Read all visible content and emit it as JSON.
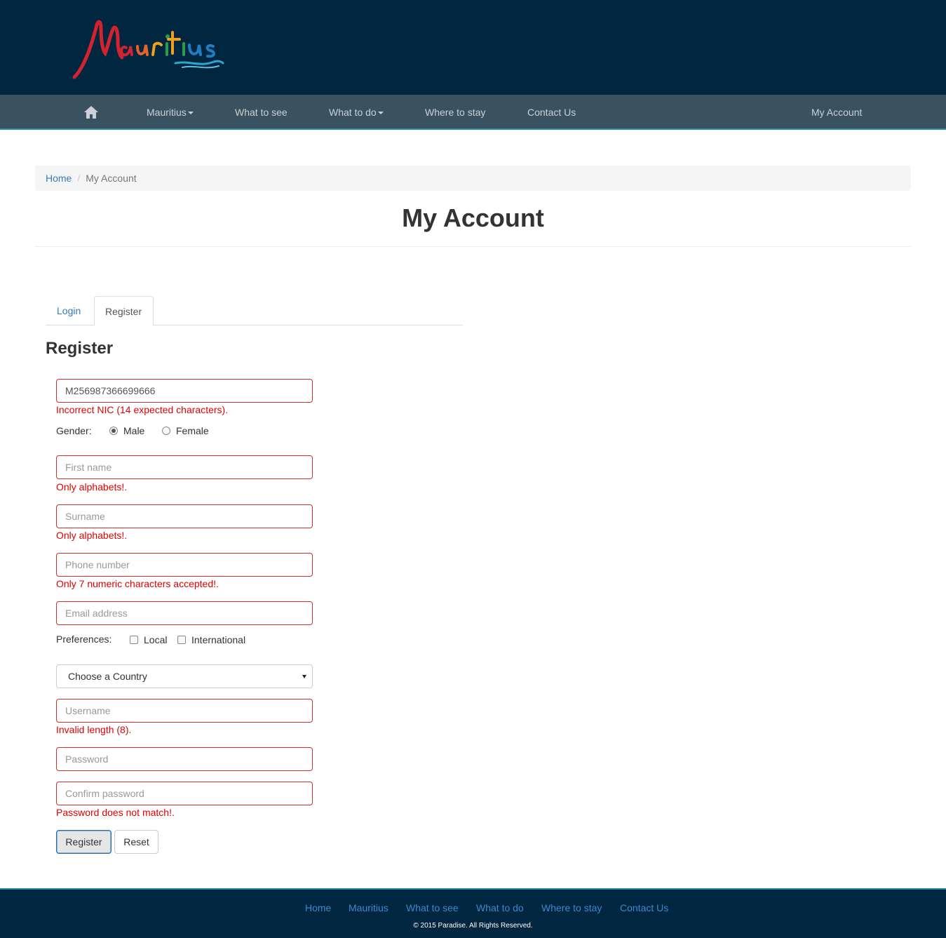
{
  "header": {
    "logo_text": "Mauritius"
  },
  "nav": {
    "home_icon": "home-icon",
    "items": [
      {
        "label": "Mauritius",
        "has_dropdown": true
      },
      {
        "label": "What to see",
        "has_dropdown": false
      },
      {
        "label": "What to do",
        "has_dropdown": true
      },
      {
        "label": "Where to stay",
        "has_dropdown": false
      },
      {
        "label": "Contact Us",
        "has_dropdown": false
      }
    ],
    "account": "My Account"
  },
  "breadcrumb": {
    "home": "Home",
    "separator": "/",
    "current": "My Account"
  },
  "page_title": "My Account",
  "tabs": {
    "login": "Login",
    "register": "Register",
    "active": "Register"
  },
  "form": {
    "heading": "Register",
    "nic": {
      "value": "M256987366699666",
      "error": "Incorrect NIC (14 expected characters)."
    },
    "gender": {
      "label": "Gender:",
      "options": [
        "Male",
        "Female"
      ],
      "selected": "Male"
    },
    "first_name": {
      "placeholder": "First name",
      "error": "Only alphabets!."
    },
    "surname": {
      "placeholder": "Surname",
      "error": "Only alphabets!."
    },
    "phone": {
      "placeholder": "Phone number",
      "error": "Only 7 numeric characters accepted!."
    },
    "email": {
      "placeholder": "Email address"
    },
    "preferences": {
      "label": "Preferences:",
      "options": [
        "Local",
        "International"
      ],
      "checked": []
    },
    "country": {
      "selected": "Choose a Country"
    },
    "username": {
      "placeholder": "Username",
      "error": "Invalid length (8)."
    },
    "password": {
      "placeholder": "Password"
    },
    "confirm_password": {
      "placeholder": "Confirm password",
      "error": "Password does not match!."
    },
    "register_button": "Register",
    "reset_button": "Reset"
  },
  "footer": {
    "links": [
      "Home",
      "Mauritius",
      "What to see",
      "What to do",
      "Where to stay",
      "Contact Us"
    ],
    "copyright": "© 2015 Paradise. All Rights Reserved."
  },
  "colors": {
    "header_bg": "#002640",
    "nav_bg": "#3a525f",
    "error": "#e00000",
    "link": "#337ab7"
  }
}
